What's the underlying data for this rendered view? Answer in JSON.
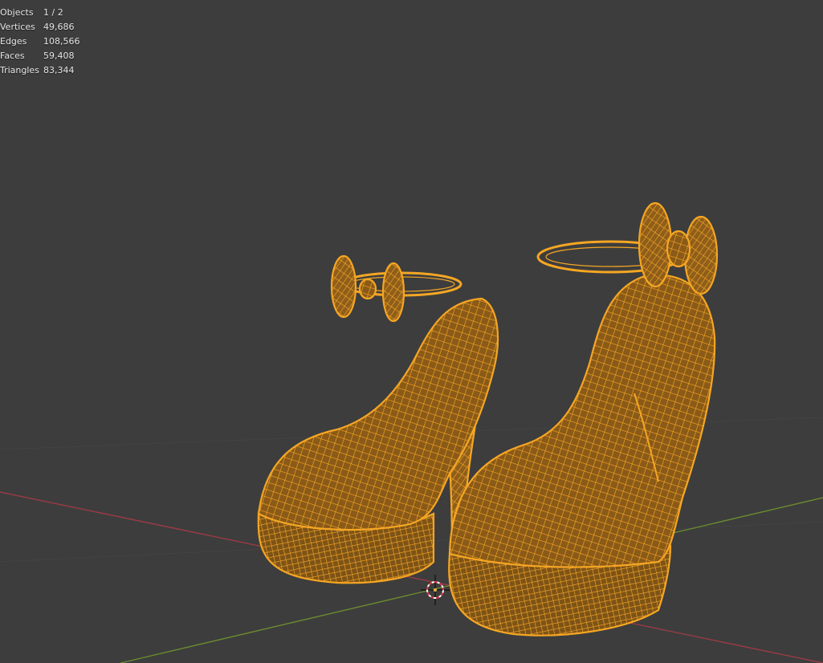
{
  "stats": {
    "rows": [
      {
        "label": "Objects",
        "value": "1 / 2"
      },
      {
        "label": "Vertices",
        "value": "49,686"
      },
      {
        "label": "Edges",
        "value": "108,566"
      },
      {
        "label": "Faces",
        "value": "59,408"
      },
      {
        "label": "Triangles",
        "value": "83,344"
      }
    ]
  },
  "colors": {
    "background": "#3d3d3d",
    "wireframe": "#f5a623",
    "x_axis": "#9a3b45",
    "y_axis": "#6b8a2f",
    "grid": "#474747"
  },
  "icons": {
    "cursor": "3d-cursor-icon"
  }
}
